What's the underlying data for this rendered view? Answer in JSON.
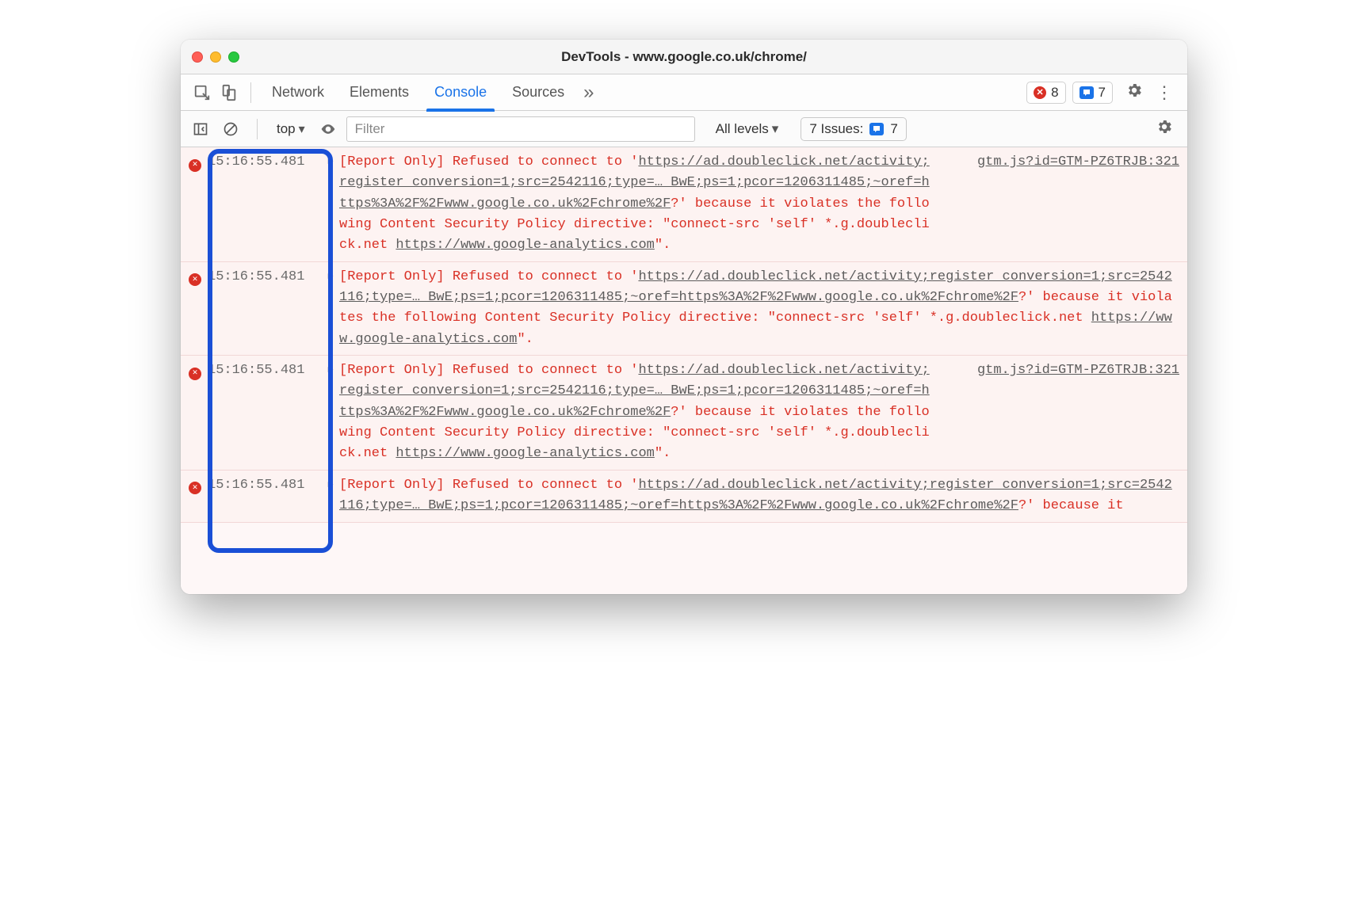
{
  "window": {
    "title": "DevTools - www.google.co.uk/chrome/"
  },
  "tabs": [
    {
      "label": "Network",
      "active": false
    },
    {
      "label": "Elements",
      "active": false
    },
    {
      "label": "Console",
      "active": true
    },
    {
      "label": "Sources",
      "active": false
    }
  ],
  "more_tabs_glyph": "»",
  "badges": {
    "errors": "8",
    "issues": "7"
  },
  "toolbar": {
    "context": "top",
    "filter_placeholder": "Filter",
    "levels": "All levels",
    "issues_label": "7 Issues:",
    "issues_count": "7"
  },
  "messages": [
    {
      "timestamp": "15:16:55.481",
      "source": "gtm.js?id=GTM-PZ6TRJB:321",
      "parts": [
        {
          "t": "text",
          "v": "[Report Only] Refused to connect to '"
        },
        {
          "t": "ul",
          "v": "https://ad.doubleclick.net/activity;register_conversion=1;src=2542116;type=… BwE;ps=1;pcor=1206311485;~oref=https%3A%2F%2Fwww.google.co.uk%2Fchrome%2F"
        },
        {
          "t": "text",
          "v": "?' because it violates the following Content Security Policy directive: \"connect-src 'self' *.g.doubleclick.net "
        },
        {
          "t": "ul",
          "v": "https://www.google-analytics.com"
        },
        {
          "t": "text",
          "v": "\"."
        }
      ]
    },
    {
      "timestamp": "15:16:55.481",
      "source": "",
      "parts": [
        {
          "t": "text",
          "v": "[Report Only] Refused to connect to '"
        },
        {
          "t": "ul",
          "v": "https://ad.doubleclick.net/activity;register_conversion=1;src=2542116;type=… BwE;ps=1;pcor=1206311485;~oref=https%3A%2F%2Fwww.google.co.uk%2Fchrome%2F"
        },
        {
          "t": "text",
          "v": "?' because it violates the following Content Security Policy directive: \"connect-src 'self' *.g.doubleclick.net "
        },
        {
          "t": "ul",
          "v": "https://www.google-analytics.com"
        },
        {
          "t": "text",
          "v": "\"."
        }
      ]
    },
    {
      "timestamp": "15:16:55.481",
      "source": "gtm.js?id=GTM-PZ6TRJB:321",
      "parts": [
        {
          "t": "text",
          "v": "[Report Only] Refused to connect to '"
        },
        {
          "t": "ul",
          "v": "https://ad.doubleclick.net/activity;register_conversion=1;src=2542116;type=… BwE;ps=1;pcor=1206311485;~oref=https%3A%2F%2Fwww.google.co.uk%2Fchrome%2F"
        },
        {
          "t": "text",
          "v": "?' because it violates the following Content Security Policy directive: \"connect-src 'self' *.g.doubleclick.net "
        },
        {
          "t": "ul",
          "v": "https://www.google-analytics.com"
        },
        {
          "t": "text",
          "v": "\"."
        }
      ]
    },
    {
      "timestamp": "15:16:55.481",
      "source": "",
      "parts": [
        {
          "t": "text",
          "v": "[Report Only] Refused to connect to '"
        },
        {
          "t": "ul",
          "v": "https://ad.doubleclick.net/activity;register_conversion=1;src=2542116;type=… BwE;ps=1;pcor=1206311485;~oref=https%3A%2F%2Fwww.google.co.uk%2Fchrome%2F"
        },
        {
          "t": "text",
          "v": "?' because it "
        }
      ]
    }
  ]
}
